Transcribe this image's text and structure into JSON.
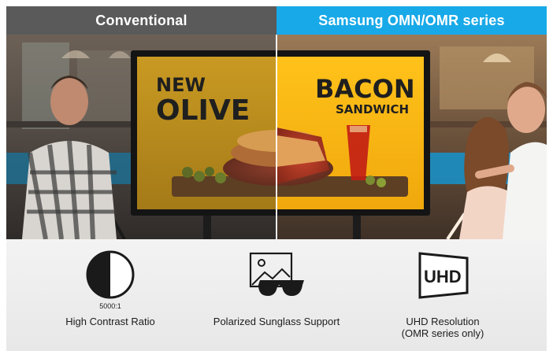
{
  "header": {
    "left_label": "Conventional",
    "right_label": "Samsung OMN/OMR series",
    "left_color": "#5a5a5a",
    "right_color": "#18a9e8"
  },
  "hero": {
    "screen_left_line1": "NEW",
    "screen_left_line2": "OLIVE",
    "screen_right_line1": "BACON",
    "screen_right_line2": "SANDWICH"
  },
  "features": {
    "contrast": {
      "icon": "half-circle-contrast-icon",
      "caption": "5000:1",
      "label": "High Contrast Ratio"
    },
    "sunglass": {
      "icon": "sunglasses-image-icon",
      "label": "Polarized Sunglass Support"
    },
    "uhd": {
      "icon": "uhd-screen-icon",
      "icon_text": "UHD",
      "label_line1": "UHD Resolution",
      "label_line2": "(OMR series only)"
    }
  }
}
